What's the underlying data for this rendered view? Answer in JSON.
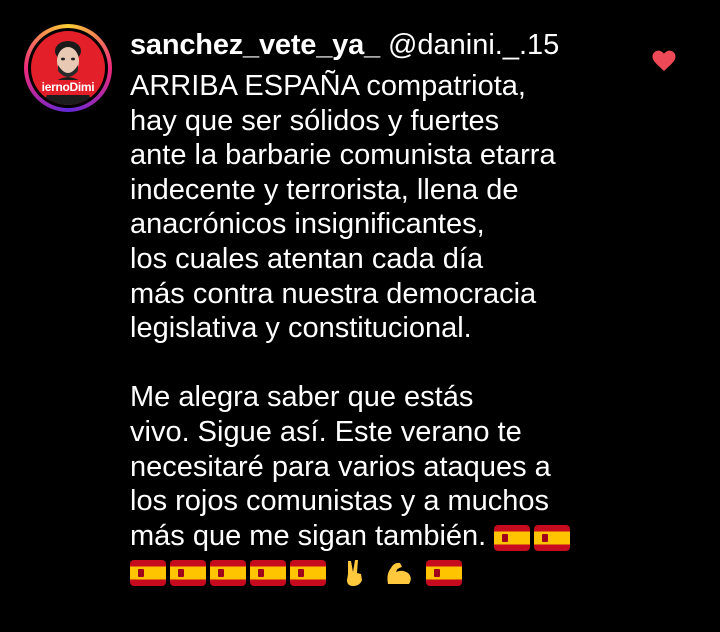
{
  "colors": {
    "background": "#000000",
    "text": "#ffffff",
    "heart": "#ed4956",
    "avatar_bg": "#e3202a",
    "flag_red": "#c60b1e",
    "flag_yellow": "#ffc400"
  },
  "comment": {
    "avatar": {
      "overlay_text": "iernoDimi"
    },
    "username": "sanchez_vete_ya_",
    "handle": "@danini._.15",
    "lines": [
      "ARRIBA ESPAÑA compatriota,",
      "hay que ser sólidos y fuertes",
      "ante la barbarie comunista etarra",
      "indecente y terrorista, llena de",
      "anacrónicos insignificantes,",
      "los cuales atentan cada día",
      "más contra nuestra democracia",
      "legislativa y constitucional.",
      "",
      "Me alegra saber que estás",
      "vivo. Sigue así. Este verano te",
      "necesitaré para varios ataques a",
      "los rojos comunistas y a muchos",
      "más que me sigan también."
    ],
    "like_icon": "heart-icon",
    "emoji_icons": [
      "spain-flag-icon",
      "victory-hand-icon",
      "flexed-biceps-icon"
    ]
  }
}
